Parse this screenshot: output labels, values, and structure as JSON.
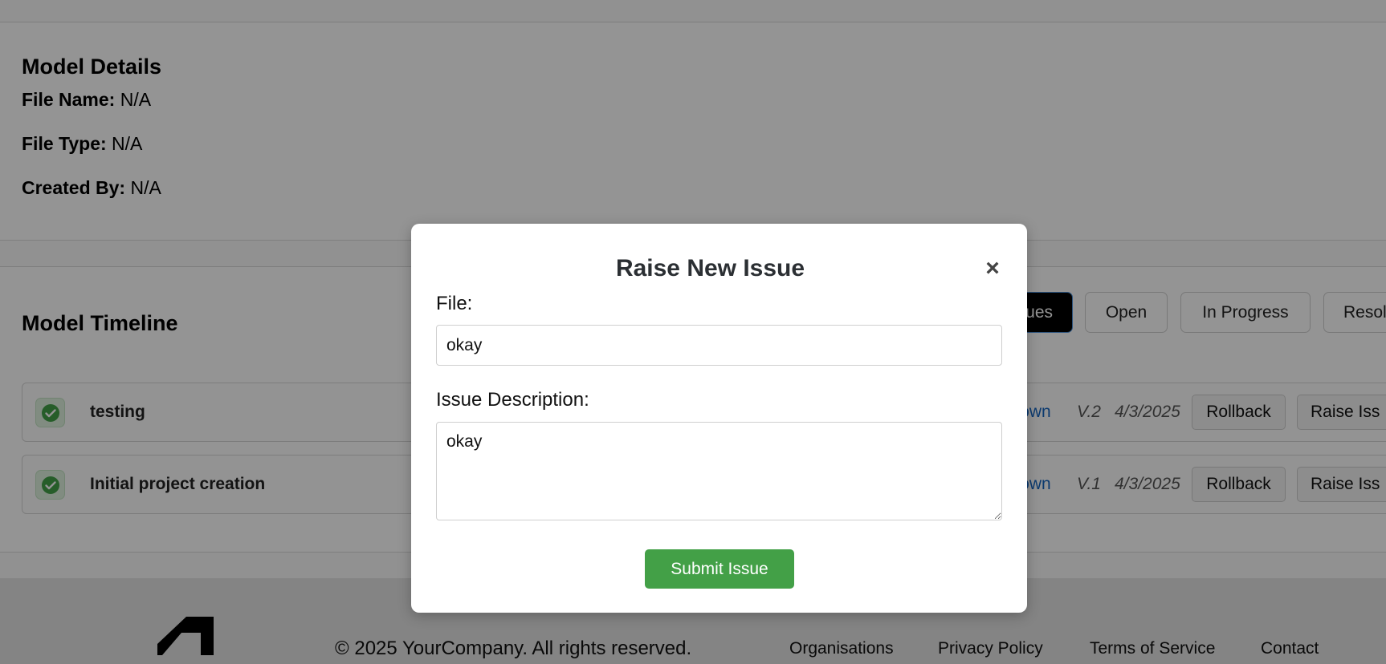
{
  "model_details": {
    "title": "Model Details",
    "file_name_label": "File Name:",
    "file_name_value": "N/A",
    "file_type_label": "File Type:",
    "file_type_value": "N/A",
    "created_by_label": "Created By:",
    "created_by_value": "N/A"
  },
  "timeline": {
    "title": "Model Timeline",
    "filters": [
      {
        "label": "ues",
        "active": true
      },
      {
        "label": "Open",
        "active": false
      },
      {
        "label": "In Progress",
        "active": false
      },
      {
        "label": "Resol",
        "active": false
      }
    ],
    "rows": [
      {
        "label": "testing",
        "user": "known",
        "version": "V.2",
        "date": "4/3/2025",
        "rollback": "Rollback",
        "raise": "Raise Iss"
      },
      {
        "label": "Initial project creation",
        "user": "known",
        "version": "V.1",
        "date": "4/3/2025",
        "rollback": "Rollback",
        "raise": "Raise Iss"
      }
    ]
  },
  "footer": {
    "copyright": "© 2025 YourCompany. All rights reserved.",
    "links": [
      "Organisations",
      "Privacy Policy",
      "Terms of Service",
      "Contact"
    ]
  },
  "modal": {
    "title": "Raise New Issue",
    "close_icon": "×",
    "file_label": "File:",
    "file_value": "okay",
    "description_label": "Issue Description:",
    "description_value": "okay",
    "submit_label": "Submit Issue"
  },
  "colors": {
    "submit_green": "#43a047",
    "link_blue": "#1565c0",
    "active_filter_bg": "#000000",
    "overlay": "rgba(0,0,0,0.42)"
  }
}
